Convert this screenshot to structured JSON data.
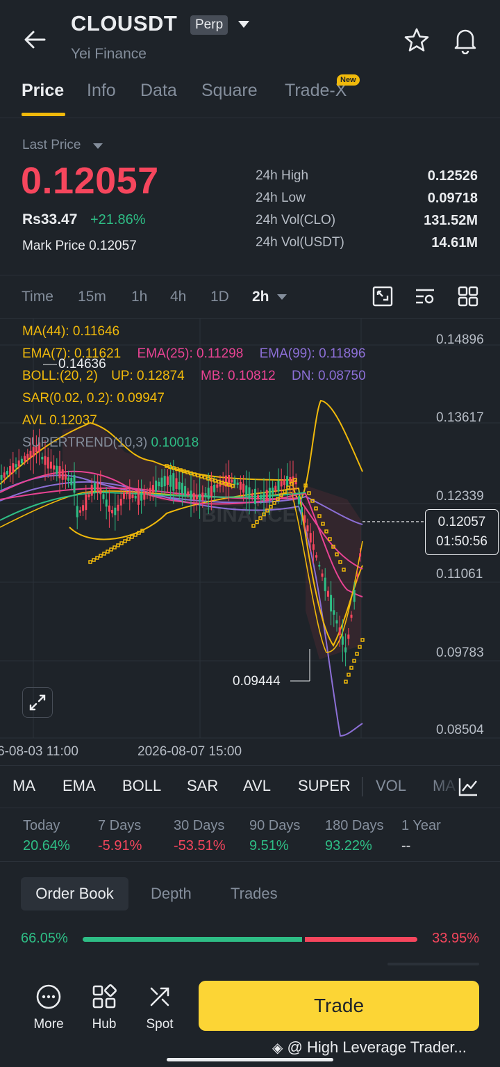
{
  "header": {
    "symbol": "CLOUSDT",
    "contract_type": "Perp",
    "subtitle": "Yei Finance"
  },
  "tabs": [
    {
      "label": "Price"
    },
    {
      "label": "Info"
    },
    {
      "label": "Data"
    },
    {
      "label": "Square"
    },
    {
      "label": "Trade-X",
      "badge": "New"
    }
  ],
  "price": {
    "last_price_label": "Last Price",
    "last_price": "0.12057",
    "fiat": "Rs33.47",
    "change": "+21.86%",
    "mark_label": "Mark Price",
    "mark_value": "0.12057",
    "stats": [
      {
        "label": "24h High",
        "value": "0.12526"
      },
      {
        "label": "24h Low",
        "value": "0.09718"
      },
      {
        "label": "24h Vol(CLO)",
        "value": "131.52M"
      },
      {
        "label": "24h Vol(USDT)",
        "value": "14.61M"
      }
    ]
  },
  "intervals": [
    "Time",
    "15m",
    "1h",
    "4h",
    "1D",
    "2h"
  ],
  "chart": {
    "indicators": {
      "ma": "MA(44): 0.11646",
      "ema7": "EMA(7): 0.11621",
      "ema25": "EMA(25): 0.11298",
      "ema99": "EMA(99): 0.11896",
      "boll": "BOLL:(20, 2)",
      "boll_up": "UP: 0.12874",
      "boll_mb": "MB: 0.10812",
      "boll_dn": "DN: 0.08750",
      "sar": "SAR(0.02, 0.2): 0.09947",
      "avl": "AVL 0.12037",
      "supertrend_label": "SUPERTREND(10,3)",
      "supertrend_value": "0.10018"
    },
    "y_axis": [
      "0.14896",
      "0.13617",
      "0.12339",
      "0.11061",
      "0.09783",
      "0.08504"
    ],
    "x_axis": [
      "6-08-03 11:00",
      "2026-08-07 15:00"
    ],
    "high_marker": "0.14636",
    "low_marker": "0.09444",
    "current_price": "0.12057",
    "countdown": "01:50:56",
    "colors": {
      "up": "#2ebd85",
      "down": "#f6465d",
      "ma": "#f0b90b",
      "ema25": "#e84393",
      "ema99": "#8c6fd6"
    }
  },
  "indicator_tabs": [
    "MA",
    "EMA",
    "BOLL",
    "SAR",
    "AVL",
    "SUPER",
    "VOL",
    "MA"
  ],
  "performance": [
    {
      "label": "Today",
      "value": "20.64%",
      "dir": "up"
    },
    {
      "label": "7 Days",
      "value": "-5.91%",
      "dir": "down"
    },
    {
      "label": "30 Days",
      "value": "-53.51%",
      "dir": "down"
    },
    {
      "label": "90 Days",
      "value": "9.51%",
      "dir": "up"
    },
    {
      "label": "180 Days",
      "value": "93.22%",
      "dir": "up"
    },
    {
      "label": "1 Year",
      "value": "--",
      "dir": "none"
    }
  ],
  "order_book": {
    "tabs": [
      "Order Book",
      "Depth",
      "Trades"
    ],
    "buy_ratio": "66.05%",
    "sell_ratio": "33.95%",
    "buy_fraction": 0.6605
  },
  "bottom_bar": {
    "items": [
      "More",
      "Hub",
      "Spot"
    ],
    "trade_label": "Trade",
    "watermark": "@ High Leverage Trader..."
  }
}
